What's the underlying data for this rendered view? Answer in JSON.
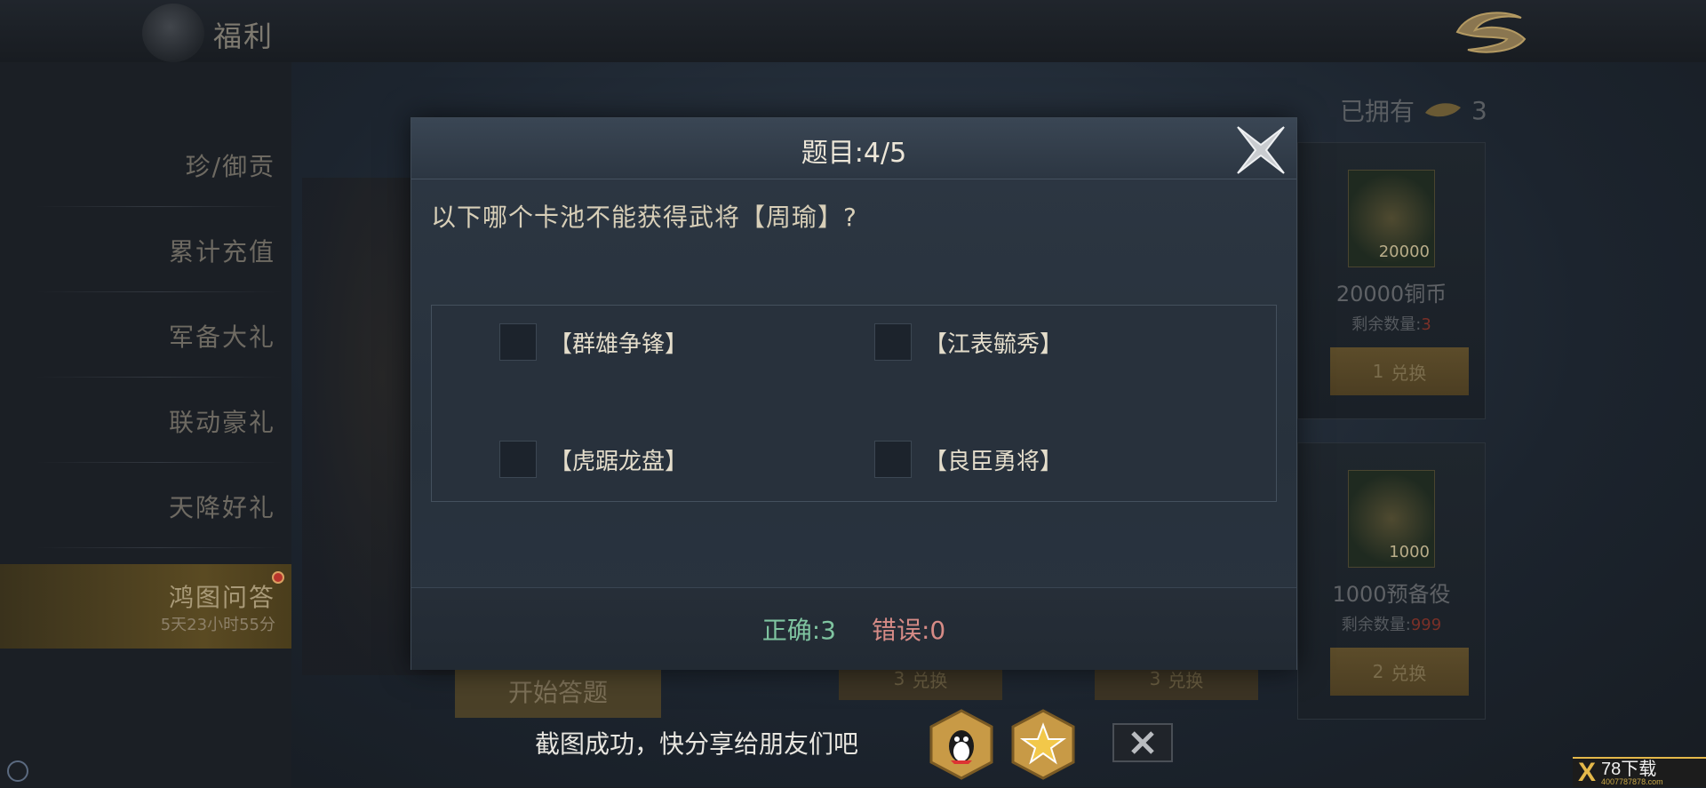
{
  "header": {
    "title": "福利"
  },
  "sidebar": {
    "items": [
      {
        "label": "珍/御贡"
      },
      {
        "label": "累计充值"
      },
      {
        "label": "军备大礼"
      },
      {
        "label": "联动豪礼"
      },
      {
        "label": "天降好礼"
      },
      {
        "label": "鸿图问答",
        "timer": "5天23小时55分",
        "active": true
      }
    ]
  },
  "shop": {
    "owned_label": "已拥有",
    "owned_count": "3",
    "items": [
      {
        "qty": "20000",
        "name": "20000铜币",
        "remain_label": "剩余数量:",
        "remain_value": "3",
        "cost": "1",
        "button": "兑换"
      },
      {
        "qty": "1000",
        "name": "1000预备役",
        "remain_label": "剩余数量:",
        "remain_value": "999",
        "cost": "2",
        "button": "兑换"
      }
    ],
    "behind_buttons": [
      {
        "cost": "3",
        "label": "兑换"
      },
      {
        "cost": "3",
        "label": "兑换"
      }
    ],
    "start_button": "开始答题"
  },
  "dialog": {
    "title": "题目:4/5",
    "question": "以下哪个卡池不能获得武将【周瑜】?",
    "options": [
      "【群雄争锋】",
      "【江表毓秀】",
      "【虎踞龙盘】",
      "【良臣勇将】"
    ],
    "correct": "正确:3",
    "wrong": "错误:0"
  },
  "share": {
    "text": "截图成功，快分享给朋友们吧",
    "icons": [
      "qq-icon",
      "qzone-icon"
    ]
  },
  "watermark": {
    "mark": "X",
    "text": "78下载",
    "sub": "4007787878.com"
  },
  "colors": {
    "correct": "#7fc4a0",
    "wrong": "#d68b86",
    "gold": "#e4b84a"
  }
}
